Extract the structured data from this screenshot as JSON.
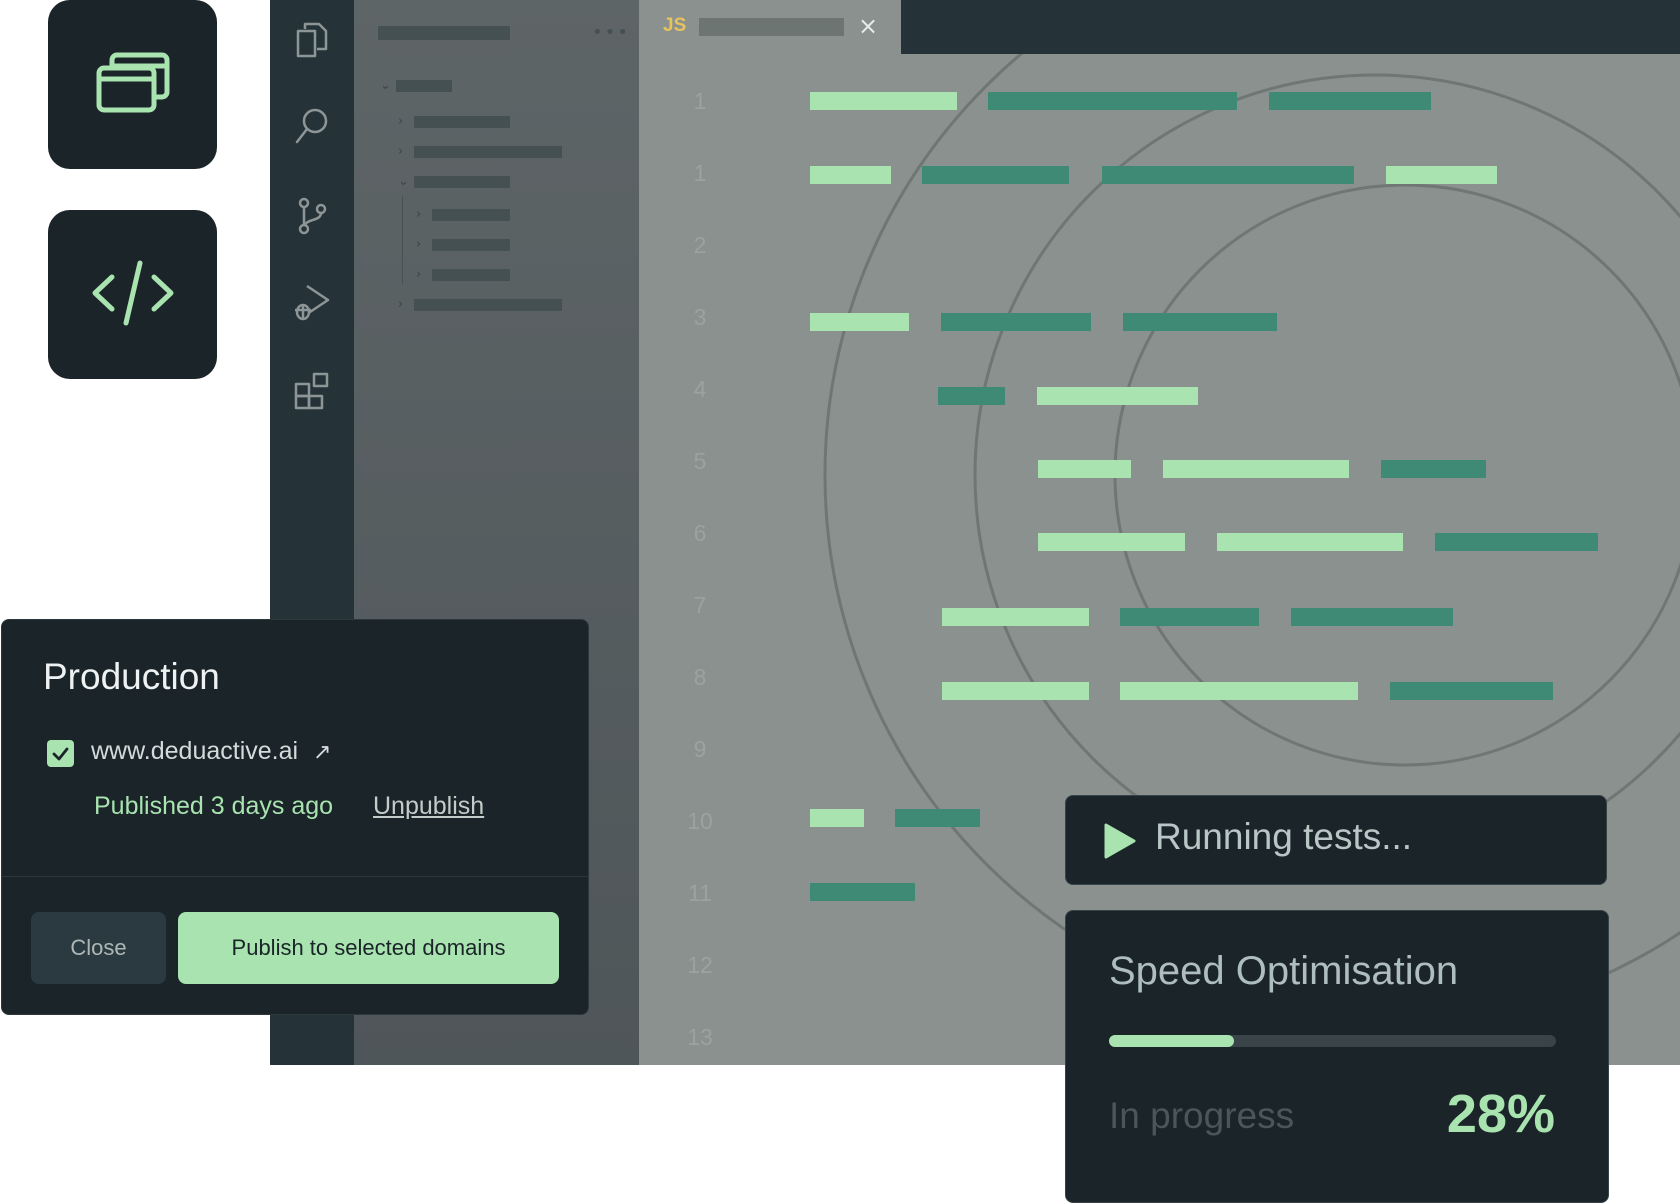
{
  "tiles": {
    "windows_icon": "browser-windows-icon",
    "code_icon": "code-brackets-icon"
  },
  "editor": {
    "activity_icons": [
      "files-icon",
      "search-icon",
      "source-control-icon",
      "run-debug-icon",
      "extensions-icon"
    ],
    "tab": {
      "language_badge": "JS",
      "close_glyph": "×"
    },
    "line_numbers": [
      "1",
      "1",
      "2",
      "3",
      "4",
      "5",
      "6",
      "7",
      "8",
      "9",
      "10",
      "11",
      "12",
      "13"
    ]
  },
  "production": {
    "title": "Production",
    "domain": "www.deduactive.ai",
    "domain_checked": true,
    "external_glyph": "↗",
    "status": "Published 3 days ago",
    "unpublish_label": "Unpublish",
    "close_label": "Close",
    "publish_label": "Publish to selected domains"
  },
  "tests": {
    "running_label": "Running tests..."
  },
  "speed": {
    "title": "Speed Optimisation",
    "status": "In progress",
    "percent_label": "28%",
    "progress": 0.28
  },
  "colors": {
    "dark": "#1b2428",
    "accent": "#a8e3b0",
    "accent_dark": "#3e8a75",
    "editor_bg": "#8a918f",
    "activity_bg": "#253338"
  }
}
